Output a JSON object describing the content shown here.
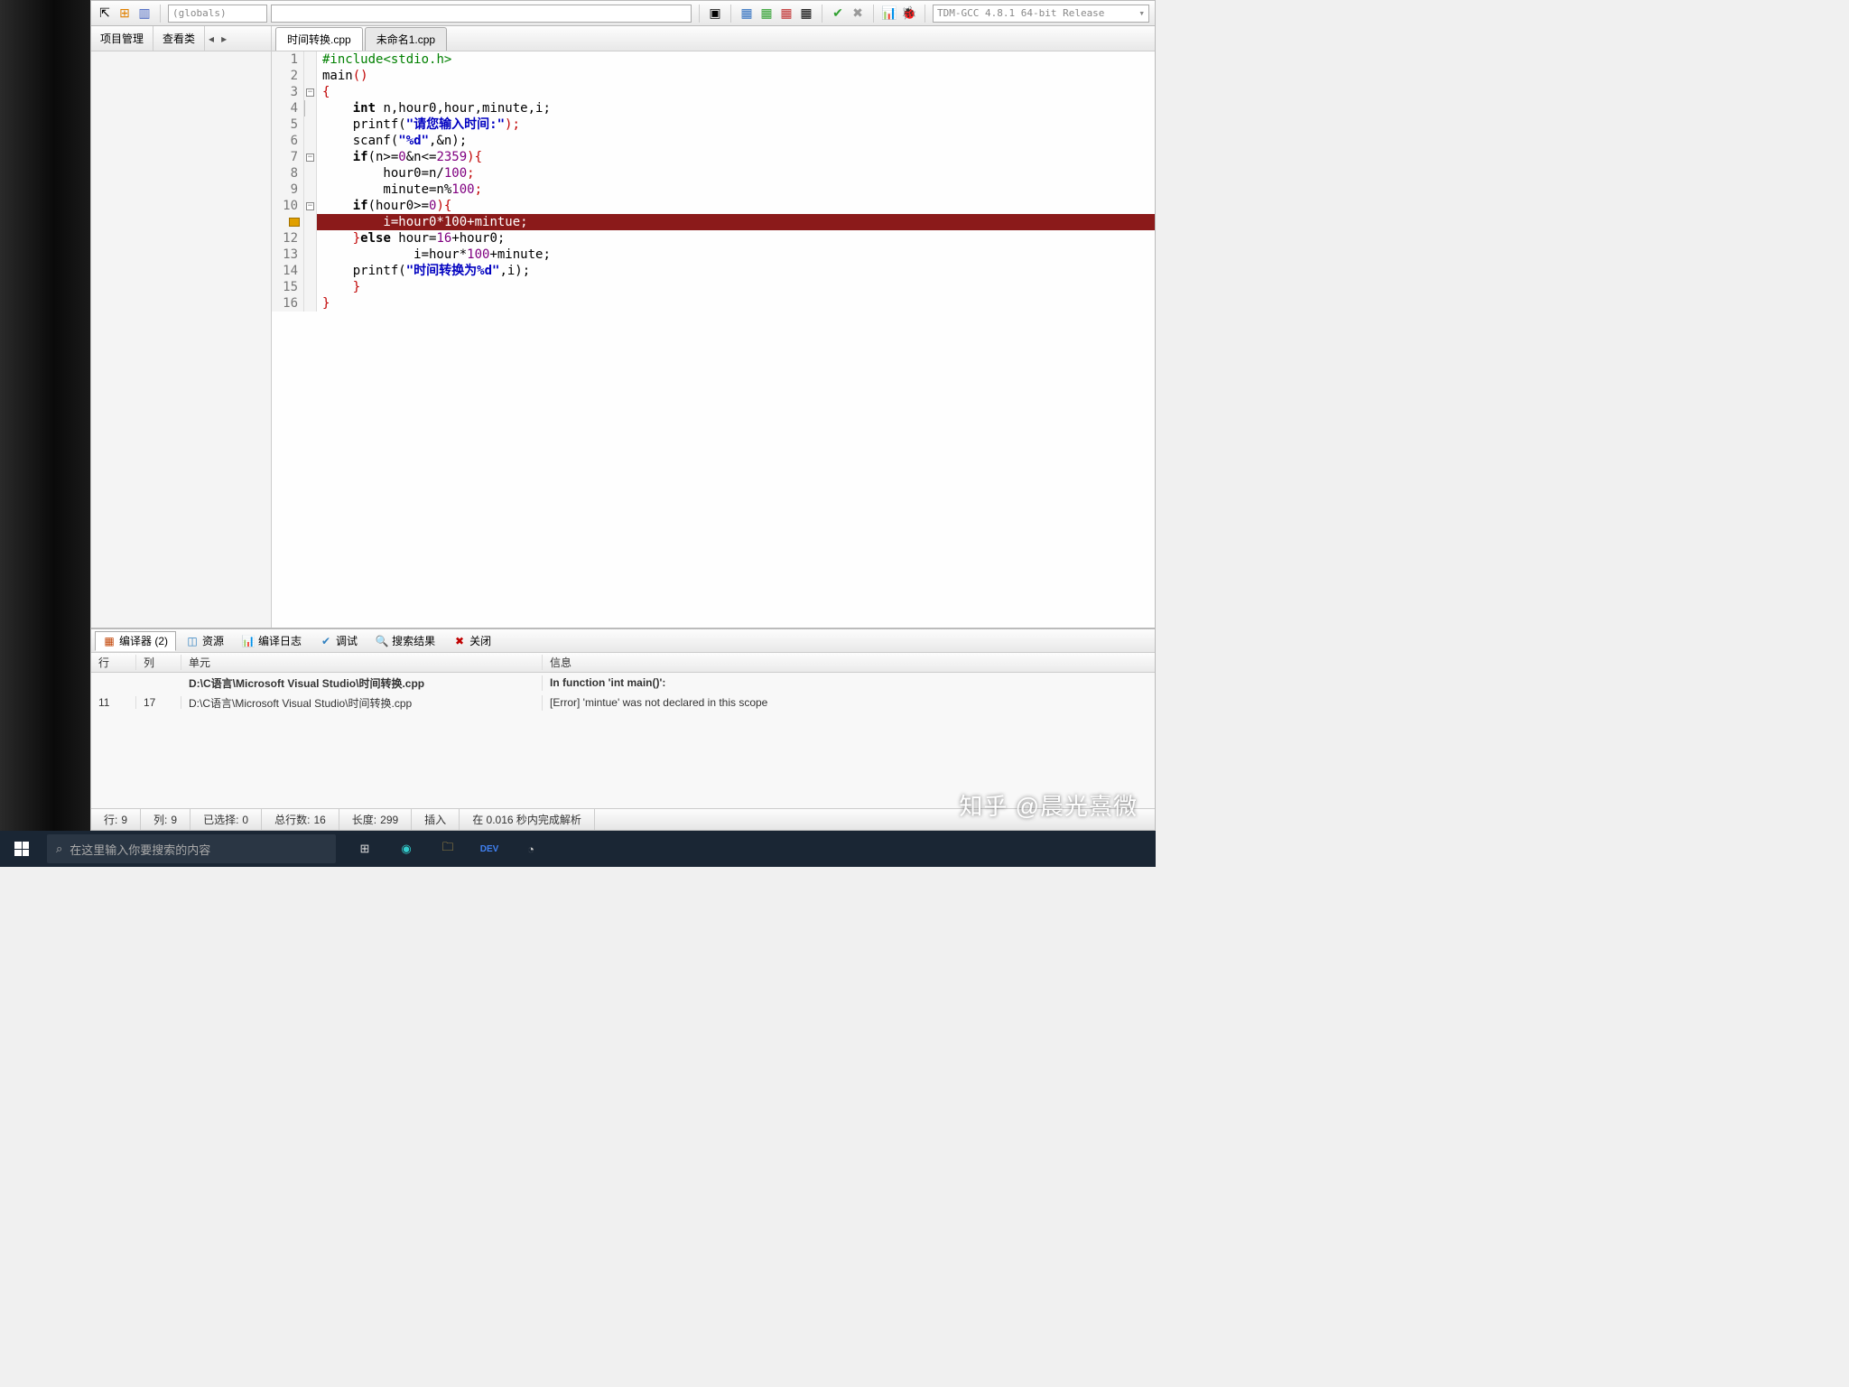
{
  "toolbar": {
    "globals": "(globals)",
    "compiler": "TDM-GCC 4.8.1 64-bit Release"
  },
  "sidebar": {
    "tab1": "项目管理",
    "tab2": "查看类"
  },
  "tabs": {
    "t1": "时间转换.cpp",
    "t2": "未命名1.cpp"
  },
  "code": {
    "l1": {
      "n": "1",
      "a": "#include",
      "b": "<stdio.h>"
    },
    "l2": {
      "n": "2",
      "a": "main",
      "b": "()"
    },
    "l3": {
      "n": "3",
      "a": "{"
    },
    "l4": {
      "n": "4",
      "a": "    ",
      "kw": "int",
      "b": " n,hour0,hour,minute,i;"
    },
    "l5": {
      "n": "5",
      "a": "    printf(",
      "s": "\"请您输入时间:\"",
      "b": ");"
    },
    "l6": {
      "n": "6",
      "a": "    scanf(",
      "s": "\"%d\"",
      "b": ",&n);"
    },
    "l7": {
      "n": "7",
      "a": "    ",
      "kw": "if",
      "b": "(n>=",
      "n1": "0",
      "c": "&n<=",
      "n2": "2359",
      "d": "){"
    },
    "l8": {
      "n": "8",
      "a": "        hour0=n/",
      "n1": "100",
      "b": ";"
    },
    "l9": {
      "n": "9",
      "a": "        minute=n%",
      "n1": "100",
      "b": ";"
    },
    "l10": {
      "n": "10",
      "a": "    ",
      "kw": "if",
      "b": "(hour0>=",
      "n1": "0",
      "c": "){"
    },
    "l11": {
      "n": "",
      "a": "        i=hour0*",
      "n1": "100",
      "b": "+mintue;"
    },
    "l12": {
      "n": "12",
      "a": "    }",
      "kw": "else",
      "b": " hour=",
      "n1": "16",
      "c": "+hour0;"
    },
    "l13": {
      "n": "13",
      "a": "            i=hour*",
      "n1": "100",
      "b": "+minute;"
    },
    "l14": {
      "n": "14",
      "a": "    printf(",
      "s": "\"时间转换为%d\"",
      "b": ",i);"
    },
    "l15": {
      "n": "15",
      "a": "    }"
    },
    "l16": {
      "n": "16",
      "a": "}"
    }
  },
  "output": {
    "compiler_tab": "编译器 (2)",
    "resources": "资源",
    "log": "编译日志",
    "debug": "调试",
    "search": "搜索结果",
    "close": "关闭",
    "h_line": "行",
    "h_col": "列",
    "h_unit": "单元",
    "h_msg": "信息",
    "r1_unit": "D:\\C语言\\Microsoft Visual Studio\\时间转换.cpp",
    "r1_msg": "In function 'int main()':",
    "r2_line": "11",
    "r2_col": "17",
    "r2_unit": "D:\\C语言\\Microsoft Visual Studio\\时间转换.cpp",
    "r2_msg": "[Error] 'mintue' was not declared in this scope"
  },
  "status": {
    "line_lbl": "行:",
    "line": "9",
    "col_lbl": "列:",
    "col": "9",
    "sel_lbl": "已选择:",
    "sel": "0",
    "total_lbl": "总行数:",
    "total": "16",
    "len_lbl": "长度:",
    "len": "299",
    "ins": "插入",
    "parse": "在 0.016 秒内完成解析"
  },
  "taskbar": {
    "search_placeholder": "在这里输入你要搜索的内容"
  },
  "watermark": "知乎 @晨光熹微"
}
